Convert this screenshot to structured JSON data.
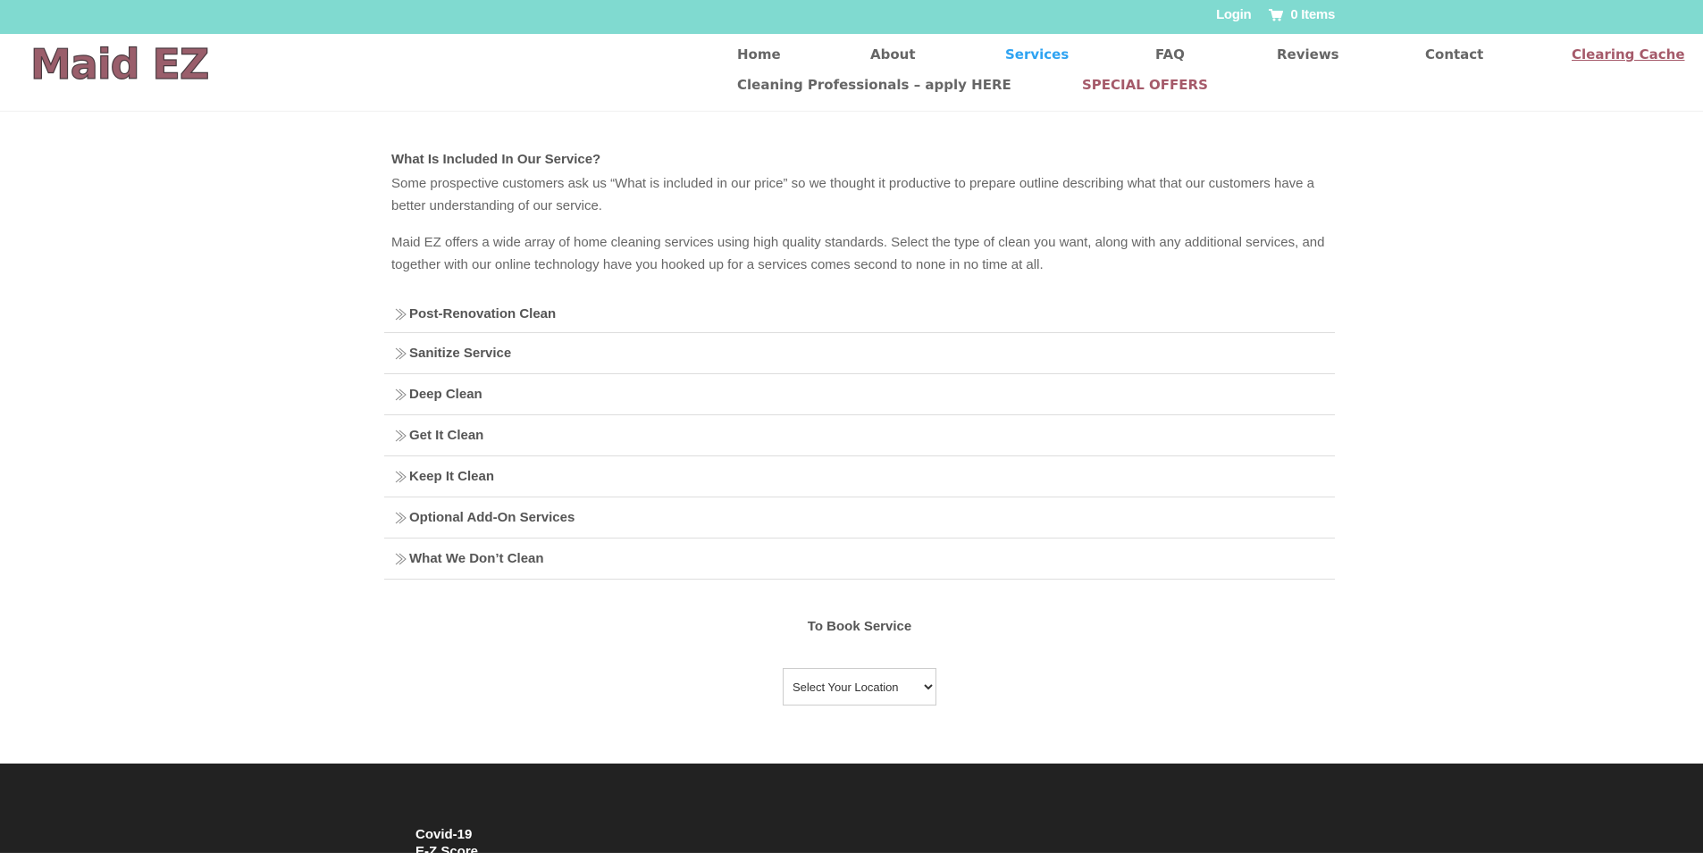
{
  "topbar": {
    "login_label": "Login",
    "cart_label": "0 Items",
    "background": "#80dad0"
  },
  "header": {
    "logo_text": "Maid EZ",
    "nav": {
      "home": "Home",
      "about": "About",
      "services": "Services",
      "faq": "FAQ",
      "reviews": "Reviews",
      "contact": "Contact",
      "clearing_cache": "Clearing Cache",
      "cleaning_professionals": "Cleaning Professionals – apply HERE",
      "special_offers": "SPECIAL OFFERS"
    },
    "active_item": "Services",
    "active_color": "#2ea3f2",
    "accent_color": "#a55a6a"
  },
  "main": {
    "intro_heading": "What Is Included In Our Service?",
    "intro_paragraph": "Some prospective customers ask us “What is included in our price” so we thought it productive to prepare outline describing what that our customers have a better understanding of our service.",
    "second_paragraph": "Maid EZ offers a wide array of home cleaning services using high quality standards. Select the type of clean you want, along with any additional services, and together with our online technology have you hooked up for a services comes second to none in no time at all.",
    "accordion": [
      {
        "label": "Post-Renovation Clean",
        "icon": "chevron-right-icon"
      },
      {
        "label": "Sanitize Service",
        "icon": "chevron-right-icon"
      },
      {
        "label": "Deep Clean",
        "icon": "chevron-right-icon"
      },
      {
        "label": "Get It Clean",
        "icon": "chevron-right-icon"
      },
      {
        "label": "Keep It Clean",
        "icon": "chevron-right-icon"
      },
      {
        "label": "Optional Add-On Services",
        "icon": "chevron-right-icon"
      },
      {
        "label": "What We Don’t Clean",
        "icon": "chevron-right-icon"
      }
    ],
    "book_heading": "To Book Service",
    "location_select": {
      "selected": "Select Your Location"
    }
  },
  "footer": {
    "background": "#222222",
    "heading": "Covid-19",
    "partial_line": "E-Z Score"
  }
}
